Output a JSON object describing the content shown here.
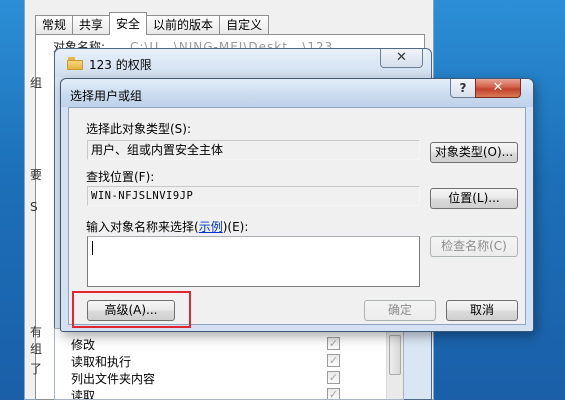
{
  "props_window": {
    "tabs": [
      "常规",
      "共享",
      "安全",
      "以前的版本",
      "自定义"
    ],
    "active_tab": "安全",
    "object_name_label": "对象名称:",
    "object_name_value": "C:\\U...\\NING-MEI\\Deskt...\\123",
    "edge_labels": [
      "组",
      "要",
      "S",
      "有",
      "组",
      "了"
    ],
    "permissions": [
      {
        "name": "修改",
        "allow": true,
        "deny": false
      },
      {
        "name": "读取和执行",
        "allow": true,
        "deny": false
      },
      {
        "name": "列出文件夹内容",
        "allow": true,
        "deny": false
      },
      {
        "name": "读取",
        "allow": true,
        "deny": false
      }
    ]
  },
  "perm_window": {
    "title": "123 的权限",
    "close_glyph": "✕"
  },
  "dialog": {
    "title": "选择用户或组",
    "help_glyph": "?",
    "close_glyph": "✕",
    "object_type_label": "选择此对象类型(S):",
    "object_type_value": "用户、组或内置安全主体",
    "object_types_button": "对象类型(O)...",
    "location_label": "查找位置(F):",
    "location_value": "WIN-NFJSLNVI9JP",
    "locations_button": "位置(L)...",
    "names_label_prefix": "输入对象名称来选择(",
    "names_label_link": "示例",
    "names_label_suffix": ")(E):",
    "names_value": "",
    "check_names_button": "检查名称(C)",
    "advanced_button": "高级(A)...",
    "ok_button": "确定",
    "cancel_button": "取消"
  },
  "colors": {
    "highlight": "#e0262e",
    "link": "#0033cc"
  }
}
